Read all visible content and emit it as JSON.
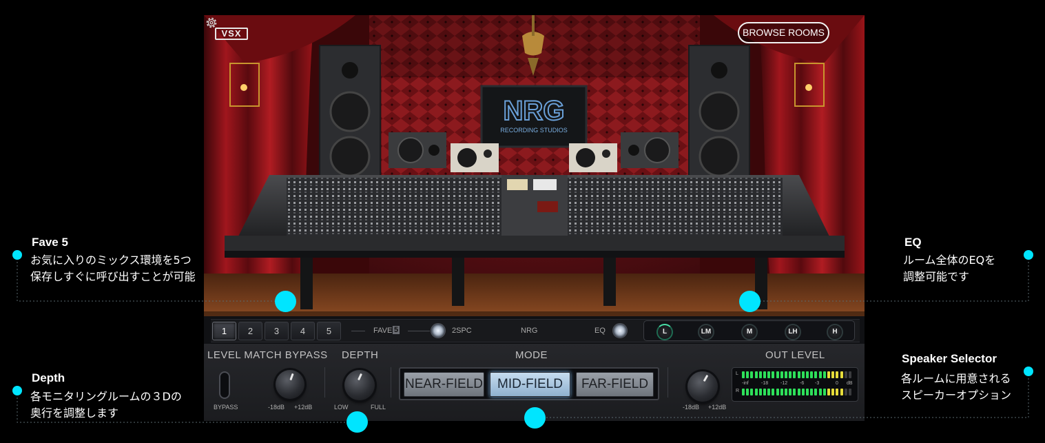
{
  "plugin": {
    "logo": "VSX",
    "browse_button": "BROWSE ROOMS",
    "settings_icon": "gear-icon",
    "sign_text": "NRG",
    "sign_subtext": "RECORDING STUDIOS"
  },
  "fave_bar": {
    "slots": [
      "1",
      "2",
      "3",
      "4",
      "5"
    ],
    "active_slot": "1",
    "fave_label": "FAVE",
    "fave_badge": "5",
    "spc_label": "2SPC",
    "room_name": "NRG",
    "eq_label": "EQ",
    "eq_bands": [
      "L",
      "LM",
      "M",
      "LH",
      "H"
    ]
  },
  "panel": {
    "level_match": {
      "title": "LEVEL MATCH BYPASS",
      "bypass_label": "BYPASS",
      "min_label": "-18dB",
      "max_label": "+12dB"
    },
    "depth": {
      "title": "DEPTH",
      "low_label": "LOW",
      "full_label": "FULL"
    },
    "mode": {
      "title": "MODE",
      "options": [
        "NEAR-FIELD",
        "MID-FIELD",
        "FAR-FIELD"
      ],
      "selected": "MID-FIELD"
    },
    "out_level": {
      "title": "OUT LEVEL",
      "min_label": "-18dB",
      "max_label": "+12dB",
      "meter_channels": [
        "L",
        "R"
      ],
      "meter_scale": [
        "-inf",
        "-18",
        "-12",
        "-6",
        "-3",
        "0",
        "dB"
      ]
    }
  },
  "annotations": {
    "fave": {
      "title": "Fave 5",
      "line1": "お気に入りのミックス環境を5つ",
      "line2": "保存しすぐに呼び出すことが可能"
    },
    "eq": {
      "title": "EQ",
      "line1": "ルーム全体のEQを",
      "line2": "調整可能です"
    },
    "depth": {
      "title": "Depth",
      "line1": "各モニタリングルームの３Dの",
      "line2": "奥行を調整します"
    },
    "speaker": {
      "title": "Speaker Selector",
      "line1": "各ルームに用意される",
      "line2": "スピーカーオプション"
    }
  },
  "colors": {
    "accent": "#00e5ff",
    "meter_green": "#2ee05a",
    "meter_yellow": "#e6dc3a",
    "mode_selected": "#a9c8e4"
  }
}
